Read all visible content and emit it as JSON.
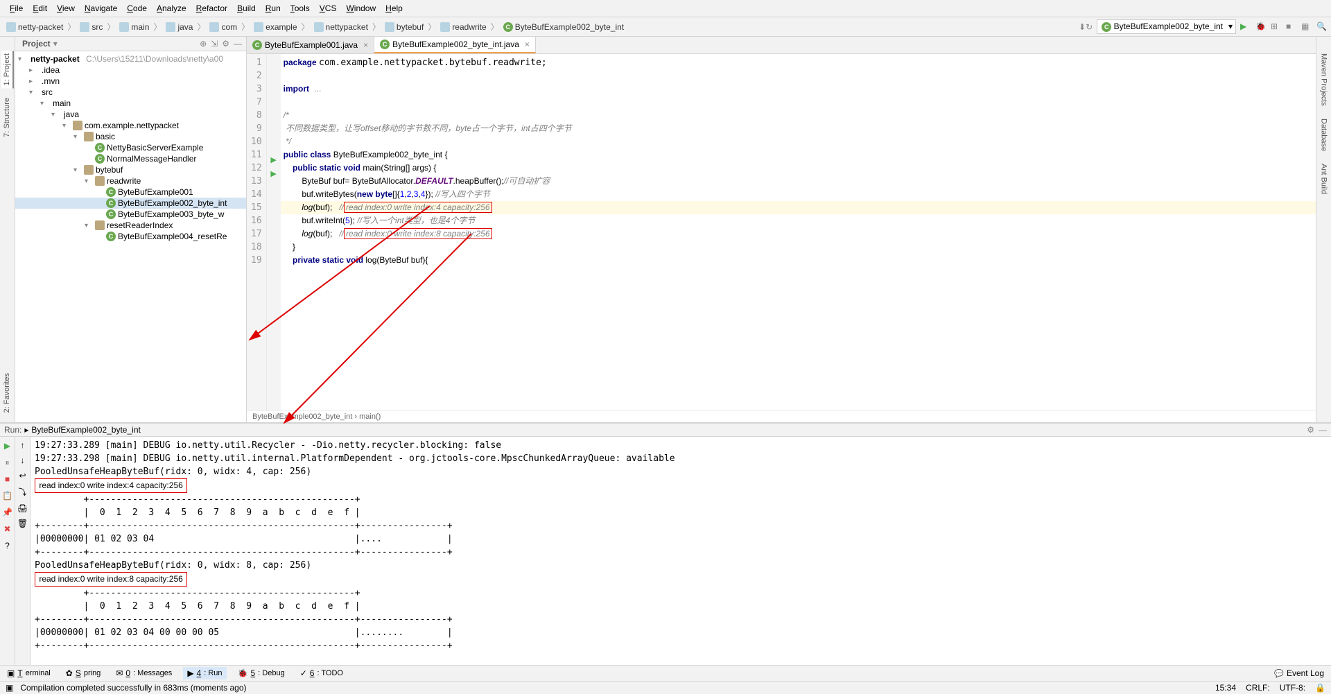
{
  "menu": [
    "File",
    "Edit",
    "View",
    "Navigate",
    "Code",
    "Analyze",
    "Refactor",
    "Build",
    "Run",
    "Tools",
    "VCS",
    "Window",
    "Help"
  ],
  "breadcrumbs": [
    {
      "ic": "folder",
      "t": "netty-packet"
    },
    {
      "ic": "folder",
      "t": "src"
    },
    {
      "ic": "folder",
      "t": "main"
    },
    {
      "ic": "folder",
      "t": "java"
    },
    {
      "ic": "folder",
      "t": "com"
    },
    {
      "ic": "folder",
      "t": "example"
    },
    {
      "ic": "folder",
      "t": "nettypacket"
    },
    {
      "ic": "folder",
      "t": "bytebuf"
    },
    {
      "ic": "folder",
      "t": "readwrite"
    },
    {
      "ic": "class",
      "t": "ByteBufExample002_byte_int"
    }
  ],
  "run_config": "ByteBufExample002_byte_int",
  "project_label": "Project",
  "project_root": {
    "name": "netty-packet",
    "path": "C:\\Users\\15211\\Downloads\\netty\\a00"
  },
  "tree": [
    {
      "d": 1,
      "ic": "folder",
      "t": ".idea",
      "exp": ">"
    },
    {
      "d": 1,
      "ic": "folder",
      "t": ".mvn",
      "exp": ">"
    },
    {
      "d": 1,
      "ic": "folder",
      "t": "src",
      "exp": "v"
    },
    {
      "d": 2,
      "ic": "folder",
      "t": "main",
      "exp": "v"
    },
    {
      "d": 3,
      "ic": "folder",
      "t": "java",
      "exp": "v"
    },
    {
      "d": 4,
      "ic": "pkg",
      "t": "com.example.nettypacket",
      "exp": "v"
    },
    {
      "d": 5,
      "ic": "pkg",
      "t": "basic",
      "exp": "v"
    },
    {
      "d": 6,
      "ic": "class",
      "t": "NettyBasicServerExample"
    },
    {
      "d": 6,
      "ic": "class",
      "t": "NormalMessageHandler"
    },
    {
      "d": 5,
      "ic": "pkg",
      "t": "bytebuf",
      "exp": "v"
    },
    {
      "d": 6,
      "ic": "pkg",
      "t": "readwrite",
      "exp": "v"
    },
    {
      "d": 7,
      "ic": "class",
      "t": "ByteBufExample001"
    },
    {
      "d": 7,
      "ic": "class",
      "t": "ByteBufExample002_byte_int",
      "sel": true
    },
    {
      "d": 7,
      "ic": "class",
      "t": "ByteBufExample003_byte_w"
    },
    {
      "d": 6,
      "ic": "pkg",
      "t": "resetReaderIndex",
      "exp": "v"
    },
    {
      "d": 7,
      "ic": "class",
      "t": "ByteBufExample004_resetRe"
    }
  ],
  "tabs": [
    {
      "t": "ByteBufExample001.java",
      "active": false
    },
    {
      "t": "ByteBufExample002_byte_int.java",
      "active": true
    }
  ],
  "lines": [
    "1",
    "2",
    "3",
    "7",
    "8",
    "9",
    "10",
    "11",
    "12",
    "13",
    "14",
    "15",
    "16",
    "17",
    "18",
    "19"
  ],
  "gutter_run": {
    "11": "▶",
    "12": "▶"
  },
  "code": {
    "l1": "package com.example.nettypacket.bytebuf.readwrite;",
    "l3": "import ...",
    "l8": "/*",
    "l9": " 不同数据类型，让写offset移动的字节数不同，byte占一个字节，int占四个字节",
    "l10": " */",
    "l11_a": "public class",
    "l11_b": " ByteBufExample002_byte_int {",
    "l12_a": "    public static void",
    "l12_b": " main(String[] args) {",
    "l13_a": "        ByteBuf buf= ByteBufAllocator.",
    "l13_b": "DEFAULT",
    "l13_c": ".heapBuffer();",
    "l13_d": "//可自动扩容",
    "l14_a": "        buf.writeBytes(",
    "l14_b": "new byte",
    "l14_c": "[]{",
    "l14_d": "1",
    "l14_e": ",",
    "l14_f": "2",
    "l14_g": ",",
    "l14_h": "3",
    "l14_i": ",",
    "l14_j": "4",
    "l14_k": "}); ",
    "l14_l": "//写入四个字节",
    "l15_a": "        log",
    "l15_b": "(buf);   ",
    "l15_c": "//",
    "l15_d": "read index:0 write index:4 capacity:256",
    "l16_a": "        buf.writeInt(",
    "l16_b": "5",
    "l16_c": "); ",
    "l16_d": "//写入一个int类型，也是4个字节",
    "l17_a": "        log",
    "l17_b": "(buf);   ",
    "l17_c": "//",
    "l17_d": "read index:0 write index:8 capacity:256",
    "l18": "    }",
    "l19_a": "    private static void",
    "l19_b": " log(ByteBuf buf){"
  },
  "crumb2": "ByteBufExample002_byte_int › main()",
  "vtabs_left": [
    "1: Project",
    "7: Structure",
    "2: Favorites"
  ],
  "vtabs_right": [
    "Maven Projects",
    "Database",
    "Ant Build"
  ],
  "run_title": "Run:",
  "run_file": "ByteBufExample002_byte_int",
  "console_lines": [
    "19:27:33.289 [main] DEBUG io.netty.util.Recycler - -Dio.netty.recycler.blocking: false",
    "19:27:33.298 [main] DEBUG io.netty.util.internal.PlatformDependent - org.jctools-core.MpscChunkedArrayQueue: available",
    "PooledUnsafeHeapByteBuf(ridx: 0, widx: 4, cap: 256)"
  ],
  "console_box1": " read index:0 write index:4 capacity:256 ",
  "console_mid": [
    "         +-------------------------------------------------+",
    "         |  0  1  2  3  4  5  6  7  8  9  a  b  c  d  e  f |",
    "+--------+-------------------------------------------------+----------------+",
    "|00000000| 01 02 03 04                                     |....            |",
    "+--------+-------------------------------------------------+----------------+",
    "PooledUnsafeHeapByteBuf(ridx: 0, widx: 8, cap: 256)"
  ],
  "console_box2": " read index:0 write index:8 capacity:256 ",
  "console_end": [
    "         +-------------------------------------------------+",
    "         |  0  1  2  3  4  5  6  7  8  9  a  b  c  d  e  f |",
    "+--------+-------------------------------------------------+----------------+",
    "|00000000| 01 02 03 04 00 00 00 05                         |........        |",
    "+--------+-------------------------------------------------+----------------+"
  ],
  "bottom": [
    {
      "ic": "▣",
      "t": "Terminal"
    },
    {
      "ic": "✿",
      "t": "Spring"
    },
    {
      "ic": "✉",
      "t": "0: Messages"
    },
    {
      "ic": "▶",
      "t": "4: Run",
      "active": true
    },
    {
      "ic": "🐞",
      "t": "5: Debug"
    },
    {
      "ic": "✓",
      "t": "6: TODO"
    }
  ],
  "eventlog": "Event Log",
  "status_msg": "Compilation completed successfully in 683ms (moments ago)",
  "status_right": [
    "15:34",
    "CRLF:",
    "UTF-8:"
  ]
}
